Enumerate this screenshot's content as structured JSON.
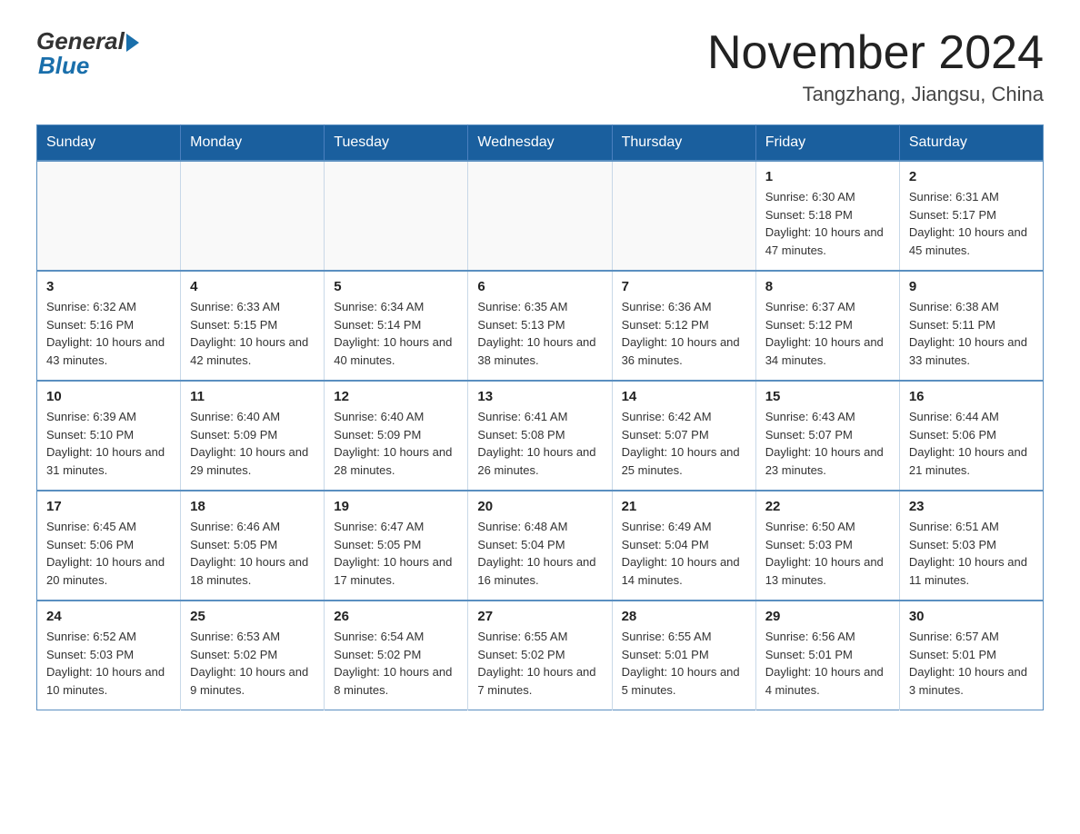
{
  "logo": {
    "general": "General",
    "blue": "Blue"
  },
  "header": {
    "title": "November 2024",
    "location": "Tangzhang, Jiangsu, China"
  },
  "days_of_week": [
    "Sunday",
    "Monday",
    "Tuesday",
    "Wednesday",
    "Thursday",
    "Friday",
    "Saturday"
  ],
  "weeks": [
    [
      {
        "day": "",
        "info": ""
      },
      {
        "day": "",
        "info": ""
      },
      {
        "day": "",
        "info": ""
      },
      {
        "day": "",
        "info": ""
      },
      {
        "day": "",
        "info": ""
      },
      {
        "day": "1",
        "info": "Sunrise: 6:30 AM\nSunset: 5:18 PM\nDaylight: 10 hours and 47 minutes."
      },
      {
        "day": "2",
        "info": "Sunrise: 6:31 AM\nSunset: 5:17 PM\nDaylight: 10 hours and 45 minutes."
      }
    ],
    [
      {
        "day": "3",
        "info": "Sunrise: 6:32 AM\nSunset: 5:16 PM\nDaylight: 10 hours and 43 minutes."
      },
      {
        "day": "4",
        "info": "Sunrise: 6:33 AM\nSunset: 5:15 PM\nDaylight: 10 hours and 42 minutes."
      },
      {
        "day": "5",
        "info": "Sunrise: 6:34 AM\nSunset: 5:14 PM\nDaylight: 10 hours and 40 minutes."
      },
      {
        "day": "6",
        "info": "Sunrise: 6:35 AM\nSunset: 5:13 PM\nDaylight: 10 hours and 38 minutes."
      },
      {
        "day": "7",
        "info": "Sunrise: 6:36 AM\nSunset: 5:12 PM\nDaylight: 10 hours and 36 minutes."
      },
      {
        "day": "8",
        "info": "Sunrise: 6:37 AM\nSunset: 5:12 PM\nDaylight: 10 hours and 34 minutes."
      },
      {
        "day": "9",
        "info": "Sunrise: 6:38 AM\nSunset: 5:11 PM\nDaylight: 10 hours and 33 minutes."
      }
    ],
    [
      {
        "day": "10",
        "info": "Sunrise: 6:39 AM\nSunset: 5:10 PM\nDaylight: 10 hours and 31 minutes."
      },
      {
        "day": "11",
        "info": "Sunrise: 6:40 AM\nSunset: 5:09 PM\nDaylight: 10 hours and 29 minutes."
      },
      {
        "day": "12",
        "info": "Sunrise: 6:40 AM\nSunset: 5:09 PM\nDaylight: 10 hours and 28 minutes."
      },
      {
        "day": "13",
        "info": "Sunrise: 6:41 AM\nSunset: 5:08 PM\nDaylight: 10 hours and 26 minutes."
      },
      {
        "day": "14",
        "info": "Sunrise: 6:42 AM\nSunset: 5:07 PM\nDaylight: 10 hours and 25 minutes."
      },
      {
        "day": "15",
        "info": "Sunrise: 6:43 AM\nSunset: 5:07 PM\nDaylight: 10 hours and 23 minutes."
      },
      {
        "day": "16",
        "info": "Sunrise: 6:44 AM\nSunset: 5:06 PM\nDaylight: 10 hours and 21 minutes."
      }
    ],
    [
      {
        "day": "17",
        "info": "Sunrise: 6:45 AM\nSunset: 5:06 PM\nDaylight: 10 hours and 20 minutes."
      },
      {
        "day": "18",
        "info": "Sunrise: 6:46 AM\nSunset: 5:05 PM\nDaylight: 10 hours and 18 minutes."
      },
      {
        "day": "19",
        "info": "Sunrise: 6:47 AM\nSunset: 5:05 PM\nDaylight: 10 hours and 17 minutes."
      },
      {
        "day": "20",
        "info": "Sunrise: 6:48 AM\nSunset: 5:04 PM\nDaylight: 10 hours and 16 minutes."
      },
      {
        "day": "21",
        "info": "Sunrise: 6:49 AM\nSunset: 5:04 PM\nDaylight: 10 hours and 14 minutes."
      },
      {
        "day": "22",
        "info": "Sunrise: 6:50 AM\nSunset: 5:03 PM\nDaylight: 10 hours and 13 minutes."
      },
      {
        "day": "23",
        "info": "Sunrise: 6:51 AM\nSunset: 5:03 PM\nDaylight: 10 hours and 11 minutes."
      }
    ],
    [
      {
        "day": "24",
        "info": "Sunrise: 6:52 AM\nSunset: 5:03 PM\nDaylight: 10 hours and 10 minutes."
      },
      {
        "day": "25",
        "info": "Sunrise: 6:53 AM\nSunset: 5:02 PM\nDaylight: 10 hours and 9 minutes."
      },
      {
        "day": "26",
        "info": "Sunrise: 6:54 AM\nSunset: 5:02 PM\nDaylight: 10 hours and 8 minutes."
      },
      {
        "day": "27",
        "info": "Sunrise: 6:55 AM\nSunset: 5:02 PM\nDaylight: 10 hours and 7 minutes."
      },
      {
        "day": "28",
        "info": "Sunrise: 6:55 AM\nSunset: 5:01 PM\nDaylight: 10 hours and 5 minutes."
      },
      {
        "day": "29",
        "info": "Sunrise: 6:56 AM\nSunset: 5:01 PM\nDaylight: 10 hours and 4 minutes."
      },
      {
        "day": "30",
        "info": "Sunrise: 6:57 AM\nSunset: 5:01 PM\nDaylight: 10 hours and 3 minutes."
      }
    ]
  ]
}
